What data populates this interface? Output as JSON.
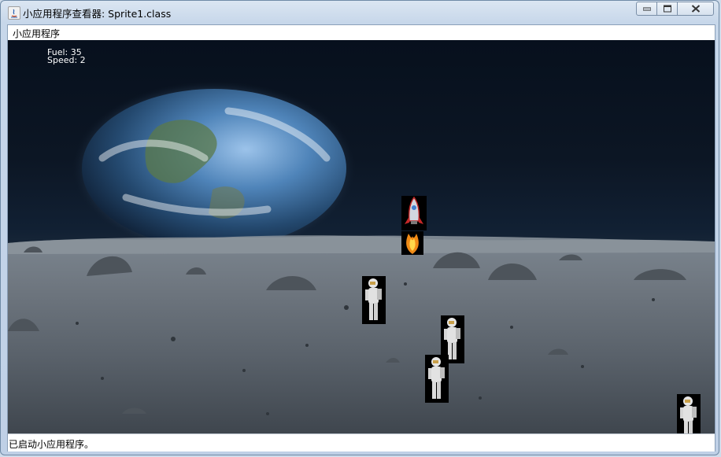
{
  "window": {
    "title": "小应用程序查看器: Sprite1.class",
    "menu_label": "小应用程序",
    "status_text": "已启动小应用程序。"
  },
  "hud": {
    "fuel_text": "Fuel: 35",
    "speed_text": "Speed: 2"
  },
  "sprites": [
    {
      "kind": "rocket",
      "name": "rocket-sprite"
    },
    {
      "kind": "flame",
      "name": "rocket-flame-sprite"
    },
    {
      "kind": "astronaut",
      "name": "astronaut-sprite"
    },
    {
      "kind": "astronaut",
      "name": "astronaut-sprite"
    },
    {
      "kind": "astronaut",
      "name": "astronaut-sprite"
    },
    {
      "kind": "astronaut",
      "name": "astronaut-sprite"
    }
  ],
  "icons": [
    "java-icon",
    "minimize-icon",
    "maximize-icon",
    "close-icon"
  ]
}
